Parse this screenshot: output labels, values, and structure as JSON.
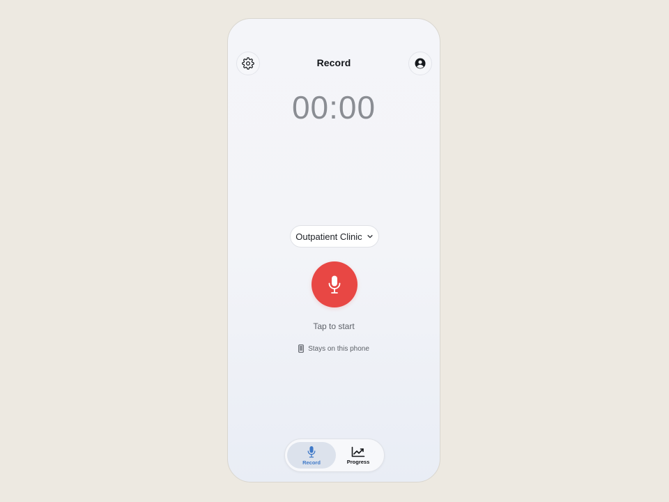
{
  "header": {
    "title": "Record",
    "settings_icon": "gear-icon",
    "profile_icon": "user-circle-icon"
  },
  "timer": {
    "display": "00:00"
  },
  "location": {
    "selected": "Outpatient Clinic",
    "icon": "chevron-down-icon"
  },
  "record": {
    "icon": "microphone-icon",
    "color": "#e84744",
    "hint": "Tap to start"
  },
  "privacy": {
    "icon": "phone-icon",
    "text": "Stays on this phone"
  },
  "tabs": [
    {
      "label": "Record",
      "icon": "microphone-icon",
      "active": true,
      "color": "#3f79c8"
    },
    {
      "label": "Progress",
      "icon": "chart-trend-icon",
      "active": false,
      "color": "#121418"
    }
  ]
}
